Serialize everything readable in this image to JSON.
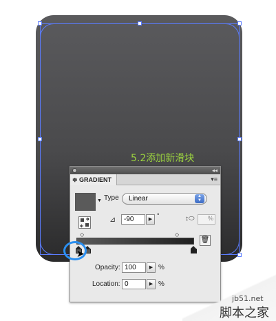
{
  "annotation": "5.2添加新滑块",
  "panel": {
    "tab_label": "≑ GRADIENT",
    "collapse_glyph": "◂◂",
    "menu_glyph": "▾≡",
    "type_label": "Type",
    "type_value": "Linear",
    "angle_value": "-90",
    "degree_symbol": "°",
    "aspect_unit": "%",
    "opacity_label": "Opacity:",
    "opacity_value": "100",
    "opacity_unit": "%",
    "location_label": "Location:",
    "location_value": "0",
    "location_unit": "%"
  },
  "gradient": {
    "start_color": "#5b5b5b",
    "end_color": "#202020",
    "stops": [
      {
        "location": 0,
        "color": "#5b5b5b"
      },
      {
        "location": 4,
        "color": "#5b5b5b"
      },
      {
        "location": 100,
        "color": "#202020"
      }
    ],
    "midpoints": [
      4,
      90
    ]
  },
  "colors": {
    "annotation": "#9bd23f",
    "selection": "#5b7cff",
    "callout": "#2b8ff0"
  },
  "watermark": {
    "site": "jb51.net",
    "name": "脚本之家"
  }
}
